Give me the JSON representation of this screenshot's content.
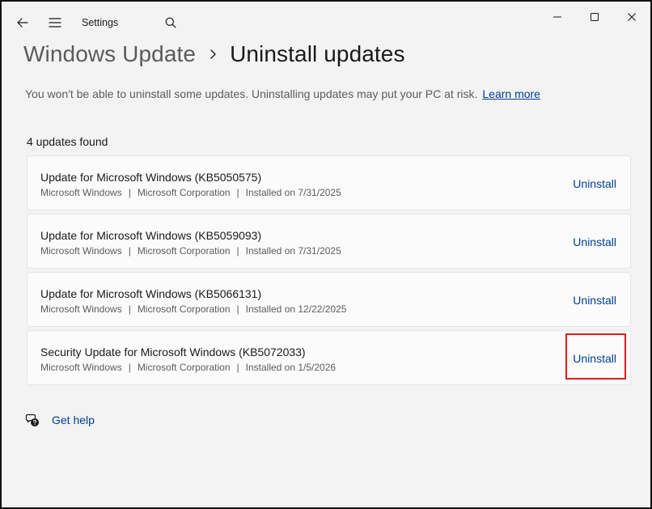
{
  "window": {
    "app_title": "Settings",
    "icons": {
      "back": "back-arrow-icon",
      "menu": "hamburger-menu-icon",
      "search": "search-icon",
      "minimize": "minimize-icon",
      "maximize": "maximize-icon",
      "close": "close-icon"
    }
  },
  "header": {
    "parent": "Windows Update",
    "separator_icon": "chevron-right-icon",
    "current": "Uninstall updates"
  },
  "warning": {
    "text": "You won't be able to uninstall some updates. Uninstalling updates may put your PC at risk.",
    "link": "Learn more"
  },
  "updates": {
    "count_label": "4 updates found",
    "items": [
      {
        "title": "Update for Microsoft Windows (KB5050575)",
        "product": "Microsoft Windows",
        "publisher": "Microsoft Corporation",
        "installed": "Installed on 7/31/2025",
        "action": "Uninstall"
      },
      {
        "title": "Update for Microsoft Windows (KB5059093)",
        "product": "Microsoft Windows",
        "publisher": "Microsoft Corporation",
        "installed": "Installed on 7/31/2025",
        "action": "Uninstall"
      },
      {
        "title": "Update for Microsoft Windows (KB5066131)",
        "product": "Microsoft Windows",
        "publisher": "Microsoft Corporation",
        "installed": "Installed on 12/22/2025",
        "action": "Uninstall"
      },
      {
        "title": "Security Update for Microsoft Windows (KB5072033)",
        "product": "Microsoft Windows",
        "publisher": "Microsoft Corporation",
        "installed": "Installed on 1/5/2026",
        "action": "Uninstall"
      }
    ],
    "meta_separator": "|"
  },
  "footer": {
    "help_icon": "help-chat-icon",
    "help_label": "Get help"
  },
  "colors": {
    "accent_link": "#003e92",
    "highlight": "#e01b1b",
    "background": "#f3f3f3",
    "card": "#fbfbfb"
  }
}
